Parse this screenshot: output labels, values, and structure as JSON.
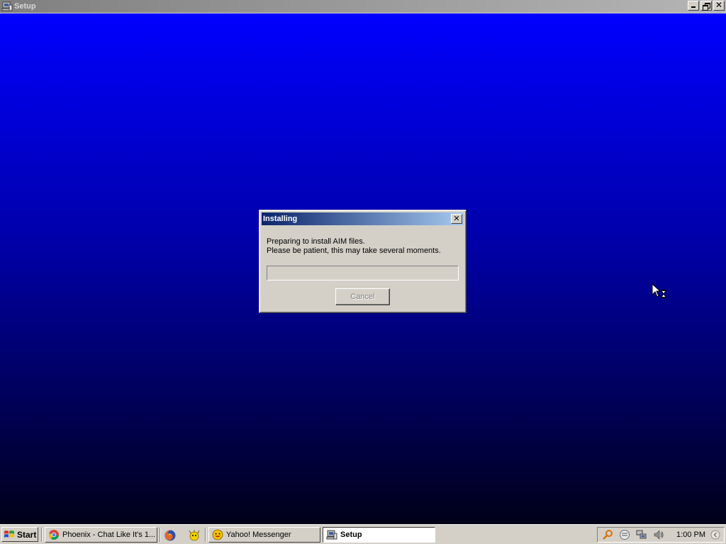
{
  "window": {
    "title": "Setup",
    "icon": "setup-computer-icon"
  },
  "dialog": {
    "title": "Installing",
    "message_line1": "Preparing to install AIM files.",
    "message_line2": "Please be patient, this may take several moments.",
    "progress_fraction": 0,
    "cancel_label": "Cancel",
    "cancel_enabled": false,
    "close_glyph": "✕"
  },
  "taskbar": {
    "start_label": "Start",
    "tasks": [
      {
        "label": "Phoenix - Chat Like It's 1...",
        "icon": "chrome-icon",
        "active": false
      },
      {
        "label": "Yahoo! Messenger",
        "icon": "yahoo-messenger-icon",
        "active": false
      },
      {
        "label": "Setup",
        "icon": "setup-computer-icon",
        "active": true
      }
    ],
    "quick_launch": [
      "firefox-icon",
      "yahoo-widget-icon"
    ],
    "tray_icons": [
      "search-icon",
      "status-icon",
      "network-icon",
      "volume-icon"
    ],
    "clock": "1:00 PM"
  },
  "colors": {
    "desktop_top": "#0000ff",
    "desktop_bottom": "#000018",
    "dialog_title_start": "#0a246a",
    "dialog_title_end": "#a6caf0",
    "face": "#d4d0c8"
  }
}
